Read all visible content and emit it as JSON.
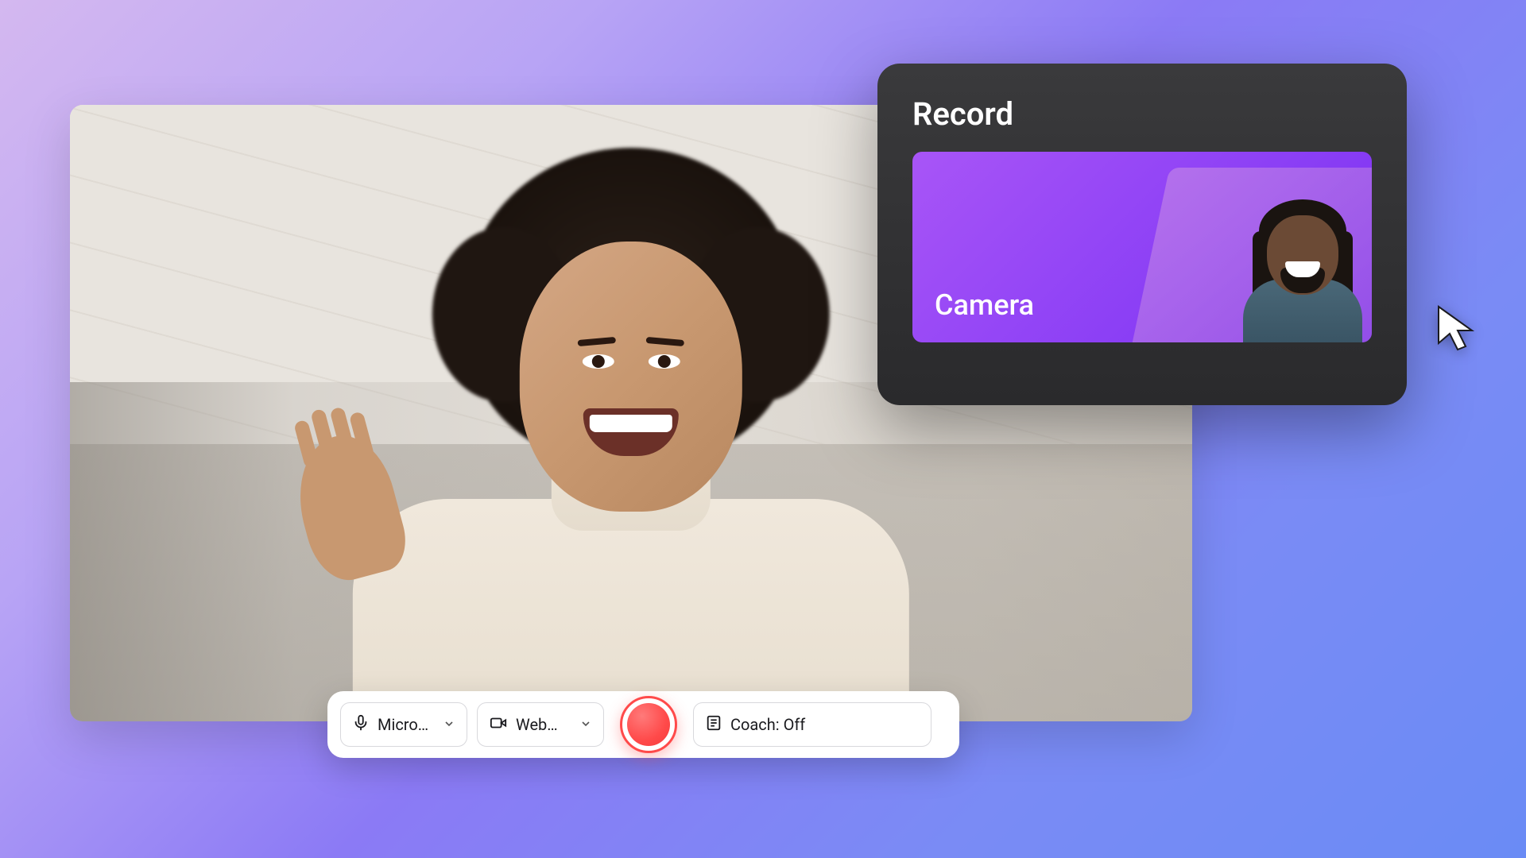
{
  "panel": {
    "title": "Record",
    "tile_label": "Camera"
  },
  "toolbar": {
    "mic": {
      "label": "Microp…"
    },
    "cam": {
      "label": "Web…"
    },
    "coach": {
      "label": "Coach: Off"
    }
  },
  "colors": {
    "record": "#ff4a4a",
    "accent": "#8b3ff5",
    "panel_bg": "#2e2e30"
  }
}
